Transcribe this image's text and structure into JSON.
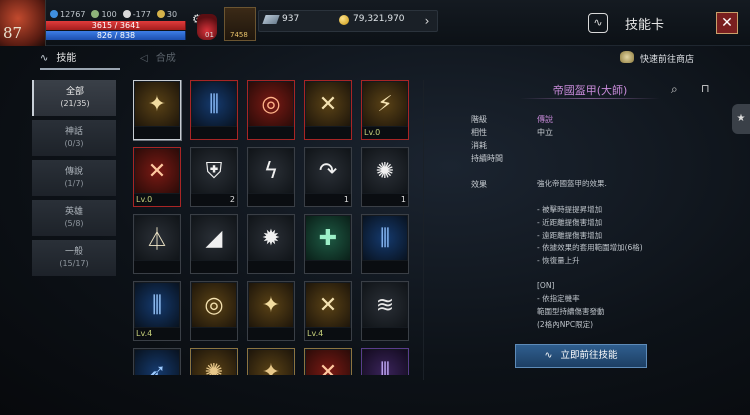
{
  "player": {
    "level": "87",
    "stat1": "12767",
    "stat2": "100",
    "stat3": "-177",
    "stat4": "30",
    "hp": "3615 / 3641",
    "hp_fraction": 0.99,
    "mp": "826 / 838",
    "mp_fraction": 0.99,
    "potion_count": "01",
    "item_count": "7458"
  },
  "currency": {
    "gems": "937",
    "gold": "79,321,970"
  },
  "header": {
    "title": "技能卡",
    "close": "✕"
  },
  "tabs": [
    {
      "label": "技能"
    },
    {
      "label": "合成"
    }
  ],
  "shop_link": "快速前往商店",
  "categories": [
    {
      "label": "全部",
      "count": "(21/35)"
    },
    {
      "label": "神話",
      "count": "(0/3)"
    },
    {
      "label": "傳說",
      "count": "(1/7)"
    },
    {
      "label": "英雄",
      "count": "(5/8)"
    },
    {
      "label": "一般",
      "count": "(15/17)"
    }
  ],
  "cards": [
    {
      "icon": "✦",
      "lv": "",
      "n": ""
    },
    {
      "icon": "⫼",
      "lv": "",
      "n": ""
    },
    {
      "icon": "◎",
      "lv": "",
      "n": ""
    },
    {
      "icon": "✕",
      "lv": "",
      "n": ""
    },
    {
      "icon": "⚡",
      "lv": "Lv.0",
      "n": ""
    },
    {
      "icon": "✕",
      "lv": "Lv.0",
      "n": ""
    },
    {
      "icon": "⛨",
      "lv": "",
      "n": "2"
    },
    {
      "icon": "ϟ",
      "lv": "",
      "n": ""
    },
    {
      "icon": "↷",
      "lv": "",
      "n": "1"
    },
    {
      "icon": "✺",
      "lv": "",
      "n": "1"
    },
    {
      "icon": "⏃",
      "lv": "",
      "n": ""
    },
    {
      "icon": "◢",
      "lv": "",
      "n": ""
    },
    {
      "icon": "✹",
      "lv": "",
      "n": ""
    },
    {
      "icon": "✚",
      "lv": "",
      "n": ""
    },
    {
      "icon": "⫼",
      "lv": "",
      "n": ""
    },
    {
      "icon": "⫼",
      "lv": "Lv.4",
      "n": ""
    },
    {
      "icon": "◎",
      "lv": "",
      "n": ""
    },
    {
      "icon": "✦",
      "lv": "",
      "n": ""
    },
    {
      "icon": "✕",
      "lv": "Lv.4",
      "n": ""
    },
    {
      "icon": "≋",
      "lv": "",
      "n": ""
    },
    {
      "icon": "➶",
      "lv": "",
      "n": ""
    },
    {
      "icon": "✺",
      "lv": "",
      "n": ""
    },
    {
      "icon": "✦",
      "lv": "",
      "n": ""
    },
    {
      "icon": "✕",
      "lv": "",
      "n": ""
    },
    {
      "icon": "⫼",
      "lv": "",
      "n": ""
    }
  ],
  "detail": {
    "title": "帝國盔甲(大師)",
    "props": [
      {
        "label": "階級",
        "value": "傳說"
      },
      {
        "label": "相性",
        "value": "中立"
      },
      {
        "label": "消耗",
        "value": ""
      },
      {
        "label": "持續時間",
        "value": ""
      }
    ],
    "effect_label": "效果",
    "effects": [
      "強化帝國盔甲的效果.",
      "",
      "- 被擊時提提昇增加",
      "- 近距離提傷害增加",
      "- 遠距離提傷害增加",
      "- 依據效果的套用範圍增加(6格)",
      "- 恢復量上升",
      "",
      "[ON]",
      "- 依指定機率",
      "範圍型持續傷害發動",
      "(2格內NPC限定)"
    ],
    "goto_button": "立即前往技能"
  }
}
